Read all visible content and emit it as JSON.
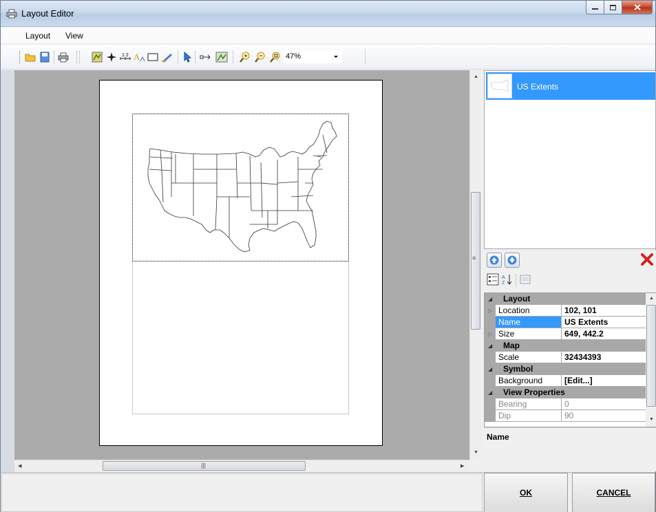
{
  "window": {
    "title": "Layout Editor",
    "icons": {
      "app": "printer-icon",
      "minimize": "minimize-icon",
      "maximize": "maximize-icon",
      "close": "close-icon"
    }
  },
  "menu": {
    "items": [
      "Layout",
      "View"
    ]
  },
  "toolbar": {
    "icons": [
      "open-icon",
      "save-icon",
      "print-icon",
      "insert-map-icon",
      "north-arrow-icon",
      "scale-bar-icon",
      "text-icon",
      "rectangle-icon",
      "legend-icon",
      "select-pointer-icon",
      "pan-icon",
      "zoom-map-icon",
      "zoom-in-icon",
      "zoom-out-icon",
      "zoom-extent-icon"
    ],
    "scale_bar_label": "1 2",
    "text_label": "A",
    "zoom_value": "47%"
  },
  "layers": {
    "items": [
      {
        "label": "US Extents",
        "selected": true
      }
    ]
  },
  "property_toolbar": {
    "icons": [
      "move-up-icon",
      "move-down-icon",
      "delete-icon",
      "categorized-icon",
      "alphabetical-icon",
      "property-pages-icon"
    ]
  },
  "properties": {
    "rows": [
      {
        "kind": "category",
        "label": "Layout"
      },
      {
        "kind": "prop",
        "name": "Location",
        "value": "102, 101",
        "expandable": true
      },
      {
        "kind": "prop",
        "name": "Name",
        "value": "US Extents",
        "selected": true
      },
      {
        "kind": "prop",
        "name": "Size",
        "value": "649, 442.2",
        "expandable": true
      },
      {
        "kind": "category",
        "label": "Map"
      },
      {
        "kind": "prop",
        "name": "Scale",
        "value": "32434393"
      },
      {
        "kind": "category",
        "label": "Symbol"
      },
      {
        "kind": "prop",
        "name": "Background",
        "value": "[Edit...]"
      },
      {
        "kind": "category",
        "label": "View Properties"
      },
      {
        "kind": "prop",
        "name": "Bearing",
        "value": "0",
        "dim": true
      },
      {
        "kind": "prop",
        "name": "Dip",
        "value": "90",
        "dim": true
      }
    ],
    "description_title": "Name"
  },
  "buttons": {
    "ok": "OK",
    "cancel": "CANCEL"
  },
  "colors": {
    "selection": "#3399ff",
    "canvas": "#ababab",
    "category_row": "#a8a8a8"
  }
}
